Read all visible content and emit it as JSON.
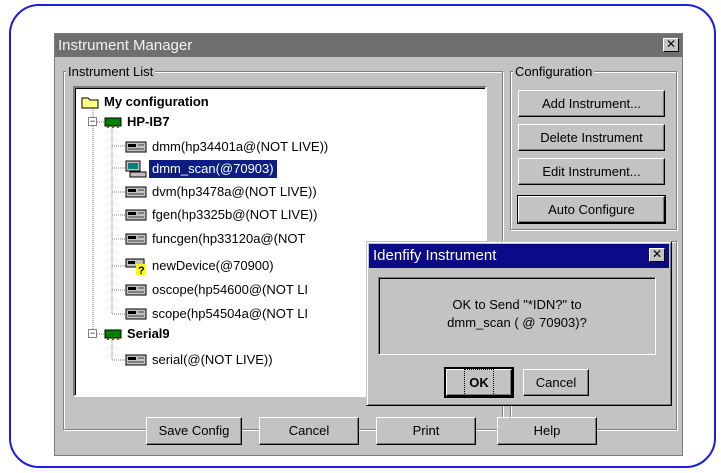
{
  "window": {
    "title": "Instrument Manager",
    "close_glyph": "✕"
  },
  "instrument_list": {
    "legend": "Instrument List",
    "root": "My configuration",
    "buses": [
      {
        "name": "HP-IB7",
        "instruments": [
          {
            "label": "dmm(hp34401a@(NOT LIVE))",
            "icon": "instrument-icon",
            "selected": false
          },
          {
            "label": "dmm_scan(@70903)",
            "icon": "scanner-icon",
            "selected": true
          },
          {
            "label": "dvm(hp3478a@(NOT LIVE))",
            "icon": "instrument-icon",
            "selected": false
          },
          {
            "label": "fgen(hp3325b@(NOT LIVE))",
            "icon": "instrument-icon",
            "selected": false
          },
          {
            "label": "funcgen(hp33120a@(NOT",
            "icon": "instrument-icon",
            "selected": false
          },
          {
            "label": "newDevice(@70900)",
            "icon": "unknown-instrument-icon",
            "selected": false
          },
          {
            "label": "oscope(hp54600@(NOT LI",
            "icon": "instrument-icon",
            "selected": false
          },
          {
            "label": "scope(hp54504a@(NOT LI",
            "icon": "instrument-icon",
            "selected": false
          }
        ]
      },
      {
        "name": "Serial9",
        "instruments": [
          {
            "label": "serial(@(NOT LIVE))",
            "icon": "instrument-icon",
            "selected": false
          }
        ]
      }
    ]
  },
  "configuration": {
    "legend": "Configuration",
    "buttons": {
      "add": "Add Instrument...",
      "delete": "Delete Instrument",
      "edit": "Edit Instrument...",
      "auto": "Auto Configure"
    }
  },
  "footer": {
    "save": "Save Config",
    "cancel": "Cancel",
    "print": "Print",
    "help": "Help"
  },
  "dialog": {
    "title": "Idenfify Instrument",
    "close_glyph": "✕",
    "message_line1": "OK to Send \"*IDN?\" to",
    "message_line2": "dmm_scan ( @ 70903)?",
    "ok": "OK",
    "cancel": "Cancel"
  },
  "colors": {
    "frame_border": "#1c1ce0",
    "title_bar": "#6f6f6f",
    "dialog_title_bar": "#0b0b87",
    "selection": "#0c1e84"
  }
}
